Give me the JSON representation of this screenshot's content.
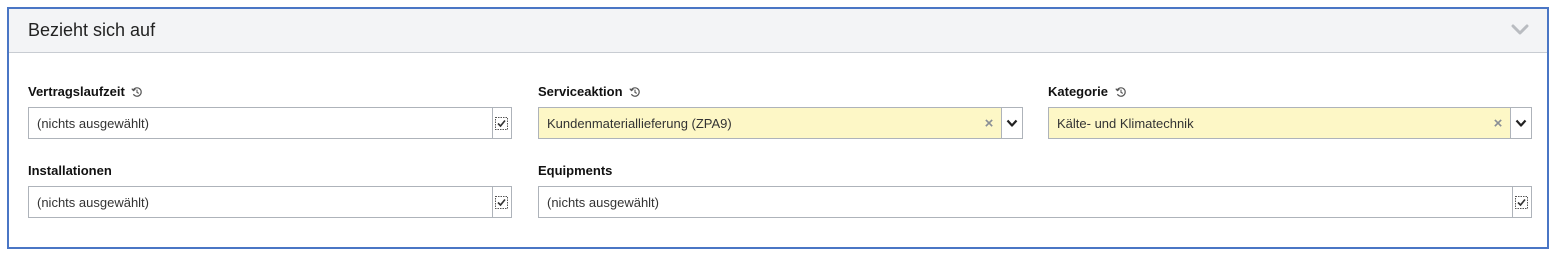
{
  "panel": {
    "title": "Bezieht sich auf",
    "collapse_icon": "chevron-down-icon"
  },
  "fields": {
    "vertragslaufzeit": {
      "label": "Vertragslaufzeit",
      "value": "(nichts ausgewählt)",
      "icon": "history-icon",
      "control": "picker"
    },
    "serviceaktion": {
      "label": "Serviceaktion",
      "value": "Kundenmateriallieferung (ZPA9)",
      "icon": "history-icon",
      "control": "dropdown",
      "clear_symbol": "×"
    },
    "kategorie": {
      "label": "Kategorie",
      "value": "Kälte- und Klimatechnik",
      "icon": "history-icon",
      "control": "dropdown",
      "clear_symbol": "×"
    },
    "installationen": {
      "label": "Installationen",
      "value": "(nichts ausgewählt)",
      "control": "picker"
    },
    "equipments": {
      "label": "Equipments",
      "value": "(nichts ausgewählt)",
      "control": "picker"
    }
  },
  "colors": {
    "panel_border": "#4a76c5",
    "header_bg": "#f3f4f6",
    "filled_field_bg": "#fdf7c6",
    "field_border": "#aeb3ba"
  }
}
